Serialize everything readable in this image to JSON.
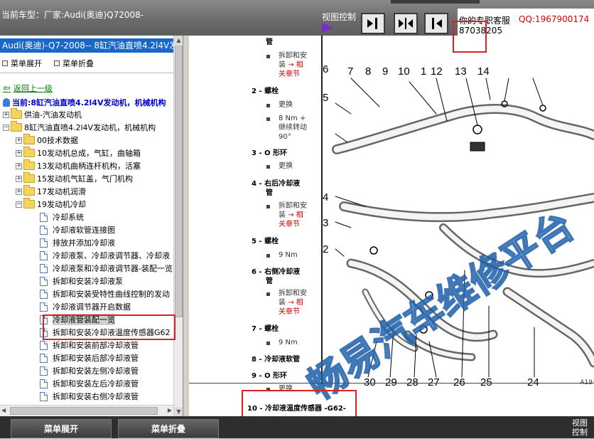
{
  "topbar": {
    "car_label": "当前车型：厂家:Audi(奥迪)Q72008-",
    "view_control_label": "视图控制",
    "agent_label": "你的专职客服",
    "qq_label": "QQ:1967900174",
    "phone_label": "87038205"
  },
  "left": {
    "model_header": "Audi(奥迪)-Q7-2008-- 8缸汽油直喷4.2l4V发",
    "expand_label": "菜单展开",
    "collapse_label": "菜单折叠",
    "back_label": "返回上一级",
    "current_label": "当前:8缸汽油直喷4.2l4V发动机，机械机构",
    "tree": [
      {
        "label": "供油-汽油发动机",
        "type": "folder",
        "toggle": "+",
        "level": 0
      },
      {
        "label": "8缸汽油直喷4.2l4V发动机，机械机构",
        "type": "folder",
        "toggle": "−",
        "level": 0
      },
      {
        "label": "00技术数据",
        "type": "folder",
        "toggle": "+",
        "level": 1
      },
      {
        "label": "10发动机总成，气缸，曲轴箱",
        "type": "folder",
        "toggle": "+",
        "level": 1
      },
      {
        "label": "13发动机曲柄连杆机构，活塞",
        "type": "folder",
        "toggle": "+",
        "level": 1
      },
      {
        "label": "15发动机气缸盖，气门机构",
        "type": "folder",
        "toggle": "+",
        "level": 1
      },
      {
        "label": "17发动机润滑",
        "type": "folder",
        "toggle": "+",
        "level": 1
      },
      {
        "label": "19发动机冷却",
        "type": "folder",
        "toggle": "−",
        "level": 1
      },
      {
        "label": "冷却系统",
        "type": "doc",
        "level": 2
      },
      {
        "label": "冷却液软管连接图",
        "type": "doc",
        "level": 2
      },
      {
        "label": "排放并添加冷却液",
        "type": "doc",
        "level": 2
      },
      {
        "label": "冷却液泵、冷却液调节器、冷却液",
        "type": "doc",
        "level": 2
      },
      {
        "label": "冷却液泵和冷却液调节器-装配一览",
        "type": "doc",
        "level": 2
      },
      {
        "label": "拆卸和安装冷却液泵",
        "type": "doc",
        "level": 2
      },
      {
        "label": "拆卸和安装受特性曲线控制的发动",
        "type": "doc",
        "level": 2
      },
      {
        "label": "冷却液调节器开启数据",
        "type": "doc",
        "level": 2
      },
      {
        "label": "冷却液管装配一览",
        "type": "doc",
        "level": 2,
        "selected": true
      },
      {
        "label": "拆卸和安装冷却液温度传感器G62",
        "type": "doc",
        "level": 2
      },
      {
        "label": "拆卸和安装前部冷却液管",
        "type": "doc",
        "level": 2
      },
      {
        "label": "拆卸和安装后部冷却液管",
        "type": "doc",
        "level": 2
      },
      {
        "label": "拆卸和安装左侧冷却液管",
        "type": "doc",
        "level": 2
      },
      {
        "label": "拆卸和安装左后冷却液管",
        "type": "doc",
        "level": 2
      },
      {
        "label": "拆卸和安装右侧冷却液管",
        "type": "doc",
        "level": 2
      }
    ]
  },
  "parts": {
    "p1_title": "管",
    "p1_a": "拆卸和安",
    "p1_b": "装",
    "p1_arrow": "→ 相",
    "p1_c": "关章节",
    "p2_title": "2 - 螺栓",
    "p2_a": "更换",
    "p2_b": "8 Nm +",
    "p2_c": "继续转动",
    "p2_d": "90°",
    "p3_title": "3 - O 形环",
    "p3_a": "更换",
    "p4_title": "4 - 右后冷却液",
    "p4_title2": "管",
    "p4_a": "拆卸和安",
    "p4_b": "装",
    "p4_arrow": "→ 相",
    "p4_c": "关章节",
    "p5_title": "5 - 螺栓",
    "p5_a": "9 Nm",
    "p6_title": "6 - 右侧冷却液",
    "p6_title2": "管",
    "p6_a": "拆卸和安",
    "p6_b": "装",
    "p6_arrow": "→ 相",
    "p6_c": "关章节",
    "p7_title": "7 - 螺栓",
    "p7_a": "9 Nm",
    "p8_title": "8 - 冷却液软管",
    "p9_title": "9 - O 形环",
    "p9_a": "更换",
    "p10_title": "10 - 冷却液温度传感器 -G62-"
  },
  "diagram": {
    "top_numbers": [
      "7",
      "8",
      "9",
      "10",
      "1",
      "12",
      "13",
      "14"
    ],
    "left_numbers": [
      "6",
      "5",
      "4",
      "3",
      "2"
    ],
    "bottom_numbers": [
      "30",
      "29",
      "28",
      "27",
      "26",
      "25",
      "24"
    ],
    "fig_code": "A19"
  },
  "watermark": "畅易汽车维修平台",
  "bottombar": {
    "expand_label": "菜单展开",
    "collapse_label": "菜单折叠",
    "view_label": "视图控制"
  },
  "colors": {
    "accent_blue": "#1a66c9",
    "highlight_red": "#e02020",
    "qq_red": "#e00000",
    "back_green": "#007a00",
    "watermark_blue": "#6ab4e6"
  }
}
